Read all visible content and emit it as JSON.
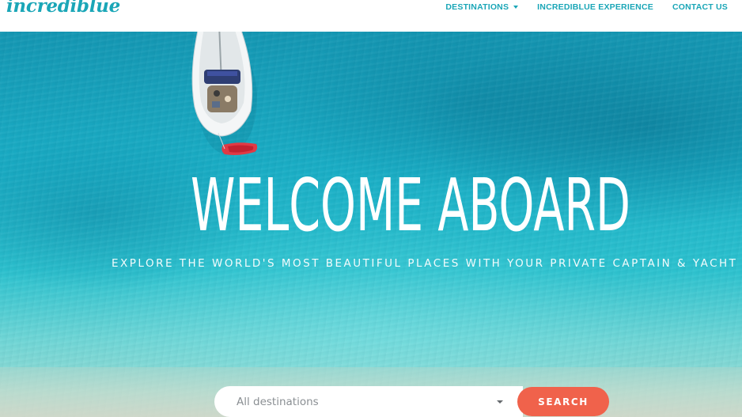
{
  "brand": {
    "logo_text": "incrediblue",
    "accent_color": "#1aa6b7",
    "cta_color": "#f0624b"
  },
  "nav": {
    "items": [
      {
        "label": "DESTINATIONS",
        "has_dropdown": true
      },
      {
        "label": "INCREDIBLUE EXPERIENCE",
        "has_dropdown": false
      },
      {
        "label": "CONTACT US",
        "has_dropdown": false
      }
    ]
  },
  "hero": {
    "title": "WELCOME ABOARD",
    "subtitle": "EXPLORE THE WORLD'S MOST BEAUTIFUL PLACES WITH YOUR PRIVATE CAPTAIN & YACHT"
  },
  "search": {
    "destination_value": "All destinations",
    "button_label": "SEARCH"
  }
}
